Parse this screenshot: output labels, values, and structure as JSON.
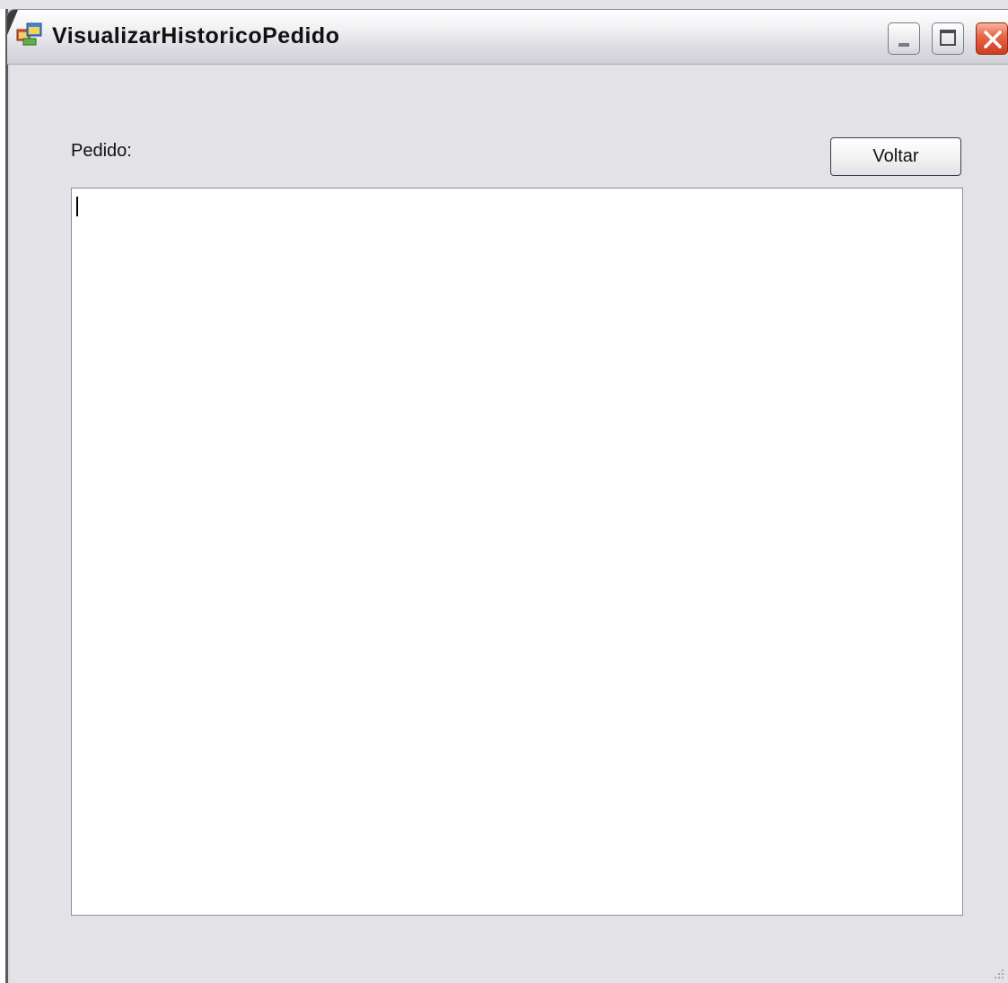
{
  "window": {
    "title": "VisualizarHistoricoPedido",
    "icon": "app-window-icon",
    "controls": {
      "minimize_icon": "minimize-icon",
      "maximize_icon": "maximize-icon",
      "close_icon": "close-icon"
    }
  },
  "form": {
    "label": "Pedido:",
    "back_button_label": "Voltar",
    "textarea_value": ""
  },
  "colors": {
    "form_background": "#e3e3e7",
    "close_button": "#e8674a",
    "textarea_background": "#ffffff"
  }
}
